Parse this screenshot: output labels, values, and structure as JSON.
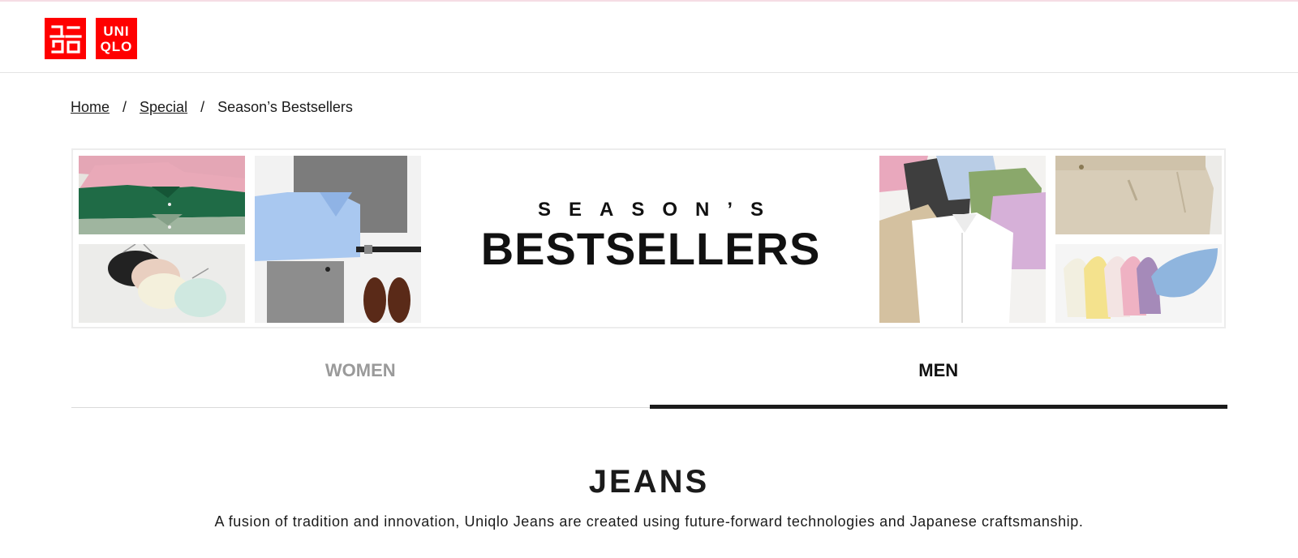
{
  "header": {
    "logo_left_lines": [
      "ユニ",
      "クロ"
    ],
    "logo_right_lines": [
      "UNI",
      "QLO"
    ],
    "brand_color": "#ff0000"
  },
  "breadcrumb": {
    "items": [
      "Home",
      "Special",
      "Season’s Bestsellers"
    ],
    "separator": "/"
  },
  "banner": {
    "kicker": "SEASON’S",
    "title": "BESTSELLERS",
    "tiles": [
      "polo-shirts-photo",
      "bras-photo",
      "shirt-suit-shoes-photo",
      "linen-shirts-photo",
      "chino-trousers-photo",
      "shoulder-bags-photo"
    ]
  },
  "tabs": [
    {
      "label": "WOMEN",
      "active": false
    },
    {
      "label": "MEN",
      "active": true
    }
  ],
  "section": {
    "title": "JEANS",
    "description": "A fusion of tradition and innovation, Uniqlo Jeans are created using future-forward technologies and Japanese craftsmanship."
  }
}
